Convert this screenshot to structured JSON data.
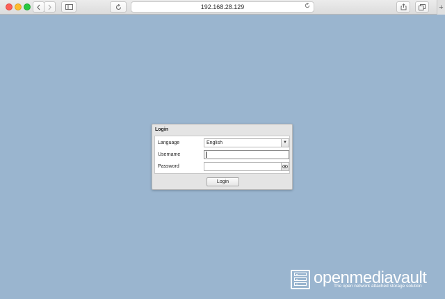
{
  "browser": {
    "address": "192.168.28.129",
    "newtab_label": "+"
  },
  "dialog": {
    "title": "Login",
    "fields": [
      {
        "label": "Language",
        "value": "English"
      },
      {
        "label": "Username",
        "value": ""
      },
      {
        "label": "Password",
        "value": ""
      }
    ],
    "login_label": "Login"
  },
  "logo": {
    "wordmark": "openmediavault",
    "tagline": "The open network attached storage solution"
  },
  "colors": {
    "background": "#9ab5cf",
    "dialog": "#e4e4e4"
  }
}
